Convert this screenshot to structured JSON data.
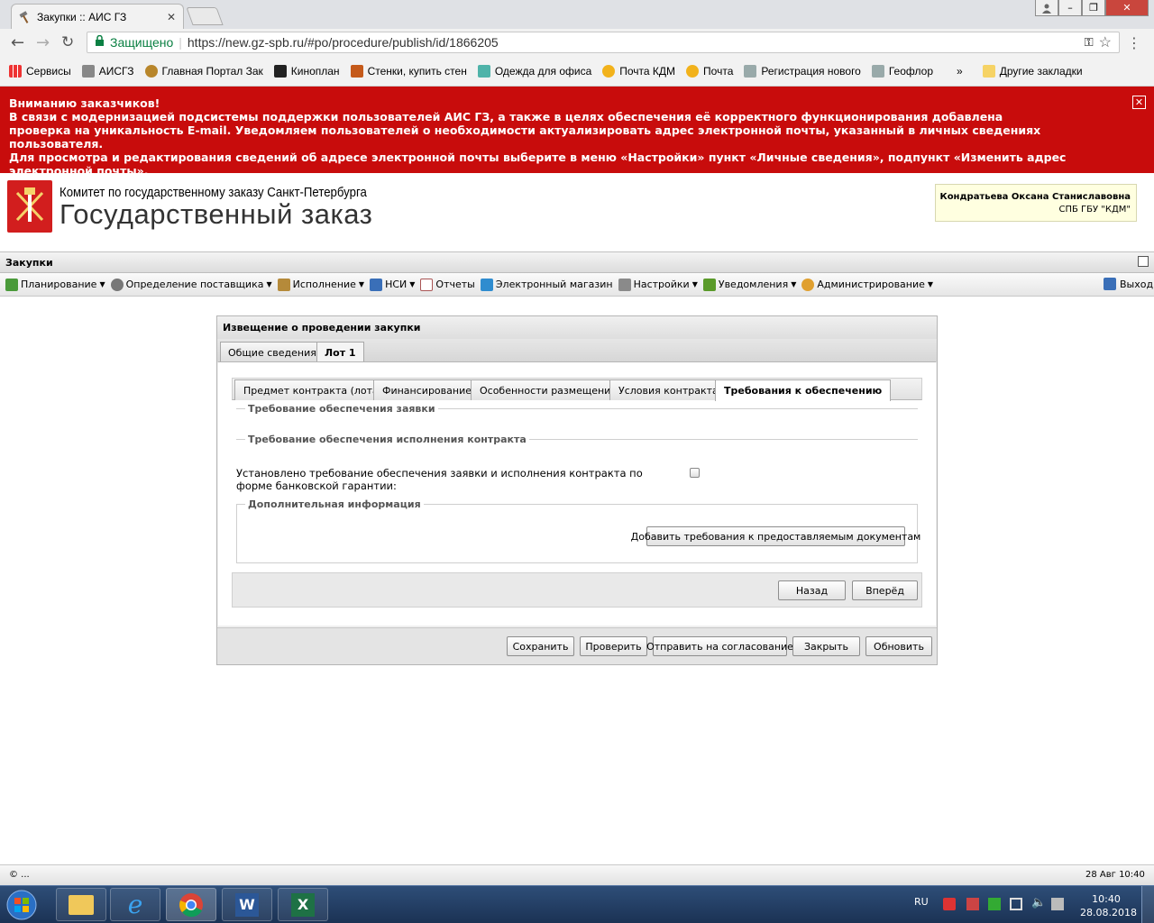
{
  "browser": {
    "tab_title": "Закупки :: АИС ГЗ",
    "secure_label": "Защищено",
    "url": "https://new.gz-spb.ru/#po/procedure/publish/id/1866205",
    "bookmarks": [
      "Сервисы",
      "АИСГЗ",
      "Главная Портал Зак",
      "Кинoплан",
      "Стенки, купить стен",
      "Одежда для офиса",
      "Почта КДМ",
      "Почта",
      "Регистрация нового",
      "Геофлор"
    ],
    "more_label": "»",
    "other_bookmarks": "Другие закладки"
  },
  "banner": {
    "line1": "Вниманию заказчиков!",
    "line2": "В связи с модернизацией подсистемы поддержки пользователей АИС ГЗ, а также в целях обеспечения её корректного функционирования добавлена проверка на уникальность E-mail. Уведомляем пользователей о необходимости актуализировать адрес электронной почты, указанный в личных сведениях пользователя.",
    "line3": "Для просмотра и редактирования сведений об адресе электронной почты выберите в меню «Настройки» пункт «Личные сведения», подпункт «Изменить адрес электронной почты».",
    "close": "✕"
  },
  "header": {
    "org_line1": "Комитет по государственному заказу Санкт-Петербурга",
    "org_line2": "Государственный заказ",
    "user_name": "Кондратьева Оксана Станиславовна",
    "user_org": "СПБ ГБУ \"КДМ\""
  },
  "panel_title": "Закупки",
  "menu": [
    "Планирование",
    "Определение поставщика",
    "Исполнение",
    "НСИ",
    "Отчеты",
    "Электронный магазин",
    "Настройки",
    "Уведомления",
    "Администрирование"
  ],
  "logout": "Выход",
  "window": {
    "title": "Извещение о проведении закупки",
    "tabs": [
      "Общие сведения",
      "Лот 1"
    ],
    "subtabs": [
      "Предмет контракта (лота)",
      "Финансирование",
      "Особенности размещения",
      "Условия контракта",
      "Требования к обеспечению"
    ],
    "fs1": "Требование обеспечения заявки",
    "fs2": "Требование обеспечения исполнения контракта",
    "bank_label": "Установлено требование обеспечения заявки и исполнения контракта по форме банковской гарантии:",
    "fs3": "Дополнительная информация",
    "add_docs_button": "Добавить требования к предоставляемым документам",
    "back_button": "Назад",
    "forward_button": "Вперёд",
    "footer_buttons": [
      "Сохранить",
      "Проверить",
      "Отправить на согласование",
      "Закрыть",
      "Обновить"
    ]
  },
  "statusbar": {
    "left": "© ...",
    "right": "28 Авг 10:40"
  },
  "taskbar": {
    "lang": "RU",
    "time": "10:40",
    "date": "28.08.2018"
  },
  "colors": {
    "banner": "#c80c0c",
    "taskbar": "#1b3254"
  }
}
